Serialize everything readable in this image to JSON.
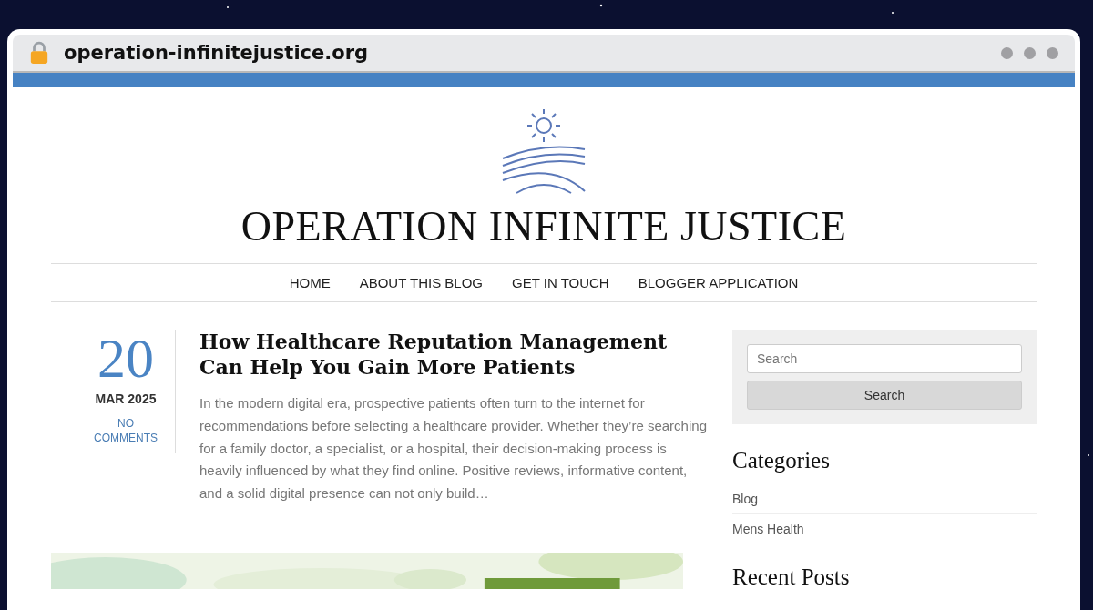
{
  "browser": {
    "address": "operation-infinitejustice.org"
  },
  "site": {
    "title": "OPERATION INFINITE JUSTICE"
  },
  "nav": [
    {
      "label": "HOME"
    },
    {
      "label": "ABOUT THIS BLOG"
    },
    {
      "label": "GET IN TOUCH"
    },
    {
      "label": "BLOGGER APPLICATION"
    }
  ],
  "post": {
    "day": "20",
    "month_year": "MAR 2025",
    "comments": "NO COMMENTS",
    "title": "How Healthcare Reputation Management Can Help You Gain More Patients",
    "excerpt": "In the modern digital era, prospective patients often turn to the internet for recommendations before selecting a healthcare provider. Whether they’re searching for a family doctor, a specialist, or a hospital, their decision-making process is heavily influenced by what they find online. Positive reviews, informative content, and a solid digital presence can not only build…"
  },
  "sidebar": {
    "search": {
      "placeholder": "Search",
      "button": "Search"
    },
    "categories": {
      "title": "Categories",
      "items": [
        {
          "label": "Blog"
        },
        {
          "label": "Mens Health"
        }
      ]
    },
    "recent_title": "Recent Posts"
  }
}
